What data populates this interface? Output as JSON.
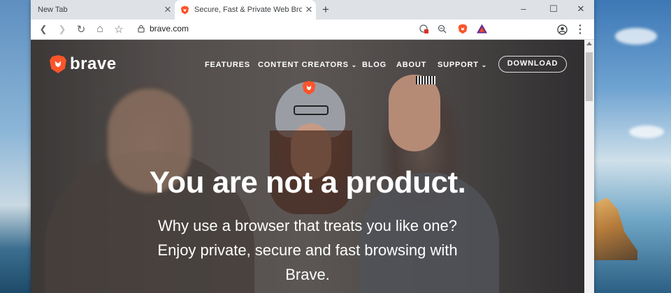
{
  "desktop": {
    "background": "#6ea3d1"
  },
  "browser": {
    "tabs": [
      {
        "title": "New Tab",
        "active": false
      },
      {
        "title": "Secure, Fast & Private Web Browser",
        "active": true
      }
    ],
    "new_tab_symbol": "+",
    "window_controls": {
      "minimize": "–",
      "maximize": "☐",
      "close": "✕"
    },
    "toolbar": {
      "back": "❮",
      "forward": "❯",
      "reload": "↻",
      "home": "⌂",
      "bookmark": "☆",
      "url": "brave.com",
      "menu": "⋮"
    }
  },
  "site": {
    "brand": "brave",
    "nav": [
      "FEATURES",
      "CONTENT CREATORS",
      "BLOG",
      "ABOUT",
      "SUPPORT"
    ],
    "download": "DOWNLOAD",
    "headline": "You are not a product.",
    "subline_1": "Why use a browser that treats you like one?",
    "subline_2": "Enjoy private, secure and fast browsing with",
    "subline_3": "Brave.",
    "colors": {
      "brand_orange": "#fb542b",
      "bat_purple": "#662d91"
    }
  }
}
